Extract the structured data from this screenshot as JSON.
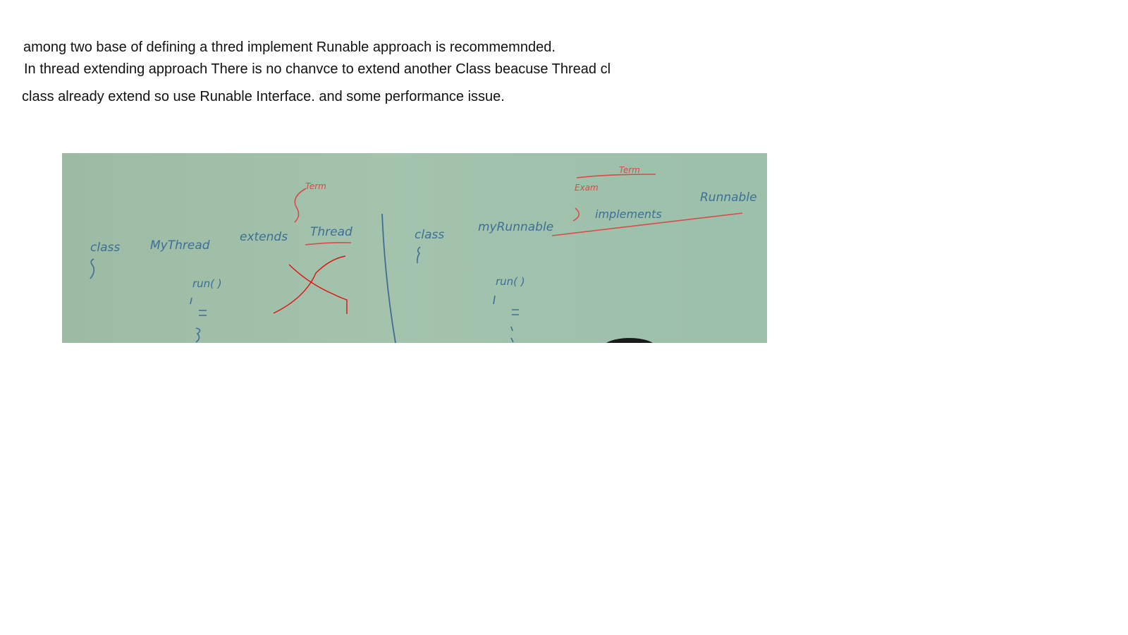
{
  "note": {
    "lines": [
      "among two base of defining a thred implement Runable approach is recommemnded.",
      "In thread extending approach There is no chanvce to extend another Class beacuse Thread cl",
      "class already extend so use Runable Interface. and some performance issue."
    ]
  },
  "whiteboard": {
    "left_panel": {
      "keyword": "class",
      "class_name": "MyThread",
      "extends_word": "extends",
      "parent": "Thread",
      "annotation": "Term",
      "method": "run( )"
    },
    "right_panel": {
      "keyword": "class",
      "class_name": "myRunnable",
      "implements_word": "implements",
      "interface": "Runnable",
      "annotation_1": "Exam",
      "annotation_2": "Term",
      "method": "run( )"
    },
    "colors": {
      "board": "#a0c0aa",
      "ink_blue": "#3d6f96",
      "ink_red": "#d94a4a",
      "marker_red": "#e01010"
    }
  }
}
